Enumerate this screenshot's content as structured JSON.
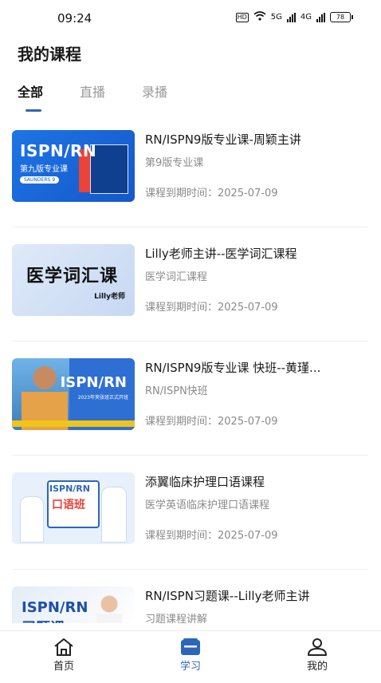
{
  "status": {
    "time": "09:24",
    "battery": "78",
    "hd": "HD",
    "net1": "5G",
    "net2": "4G"
  },
  "page_title": "我的课程",
  "tabs": [
    {
      "label": "全部",
      "active": true
    },
    {
      "label": "直播",
      "active": false
    },
    {
      "label": "录播",
      "active": false
    }
  ],
  "courses": [
    {
      "title": "RN/ISPN9版专业课-周颖主讲",
      "subtitle": "第9版专业课",
      "expiry": "课程到期时间：2025-07-09",
      "thumb": {
        "line1": "ISPN/RN",
        "line2": "第九版专业课",
        "line3": "SAUNDERS 9"
      }
    },
    {
      "title": "Lilly老师主讲--医学词汇课程",
      "subtitle": "医学词汇课程",
      "expiry": "课程到期时间：2025-07-09",
      "thumb": {
        "line1": "医学词汇课",
        "line2": "Lilly老师"
      }
    },
    {
      "title": "RN/ISPN9版专业课 快班--黄瑾...",
      "subtitle": "RN/ISPN快班",
      "expiry": "课程到期时间：2025-07-09",
      "thumb": {
        "line1": "ISPN/RN",
        "line2": "2023年夹张班正式开班"
      }
    },
    {
      "title": "添翼临床护理口语课程",
      "subtitle": "医学英语临床护理口语课程",
      "expiry": "课程到期时间：2025-07-09",
      "thumb": {
        "line1": "ISPN/RN",
        "line2": "口语班"
      }
    },
    {
      "title": "RN/ISPN习题课--Lilly老师主讲",
      "subtitle": "习题课程讲解",
      "expiry": "",
      "thumb": {
        "line1": "ISPN/RN",
        "line2": "习题课"
      }
    }
  ],
  "nav": [
    {
      "label": "首页",
      "icon": "home-icon",
      "active": false
    },
    {
      "label": "学习",
      "icon": "study-icon",
      "active": true
    },
    {
      "label": "我的",
      "icon": "profile-icon",
      "active": false
    }
  ],
  "colors": {
    "accent": "#2b67b8",
    "muted": "#8a8a8a"
  }
}
